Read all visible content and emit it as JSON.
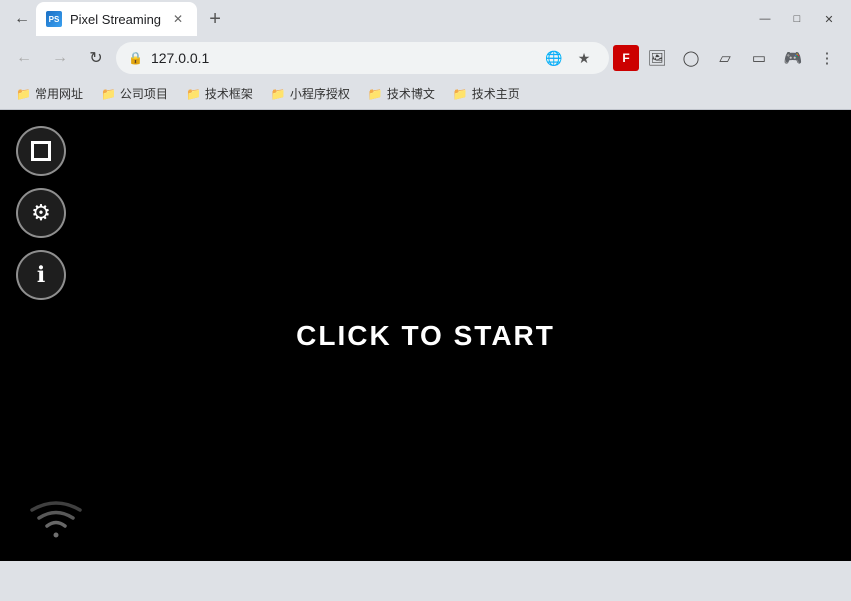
{
  "titlebar": {
    "tab": {
      "title": "Pixel Streaming",
      "favicon_text": "PS"
    },
    "new_tab_label": "+",
    "controls": {
      "minimize": "—",
      "maximize": "□",
      "close": "✕"
    }
  },
  "addressbar": {
    "back_label": "←",
    "forward_label": "→",
    "refresh_label": "↻",
    "url": "127.0.0.1",
    "translate_icon": "⊞",
    "star_icon": "☆",
    "toolbar_buttons": [
      {
        "name": "profile-icon",
        "icon": "F"
      },
      {
        "name": "image-icon",
        "icon": "🖼"
      },
      {
        "name": "extensions-icon",
        "icon": "⊕"
      },
      {
        "name": "battery-icon",
        "icon": "⬡"
      },
      {
        "name": "splitscreen-icon",
        "icon": "▭"
      },
      {
        "name": "gamepad-icon",
        "icon": "🎮"
      },
      {
        "name": "menu-icon",
        "icon": "⋮"
      }
    ]
  },
  "bookmarks": [
    {
      "label": "常用网址",
      "icon": "📁"
    },
    {
      "label": "公司项目",
      "icon": "📁"
    },
    {
      "label": "技术框架",
      "icon": "📁"
    },
    {
      "label": "小程序授权",
      "icon": "📁"
    },
    {
      "label": "技术博文",
      "icon": "📁"
    },
    {
      "label": "技术主页",
      "icon": "📁"
    }
  ],
  "overlay": {
    "expand_title": "Fullscreen",
    "settings_title": "Settings",
    "info_title": "Info",
    "click_to_start": "CLICK TO START"
  }
}
